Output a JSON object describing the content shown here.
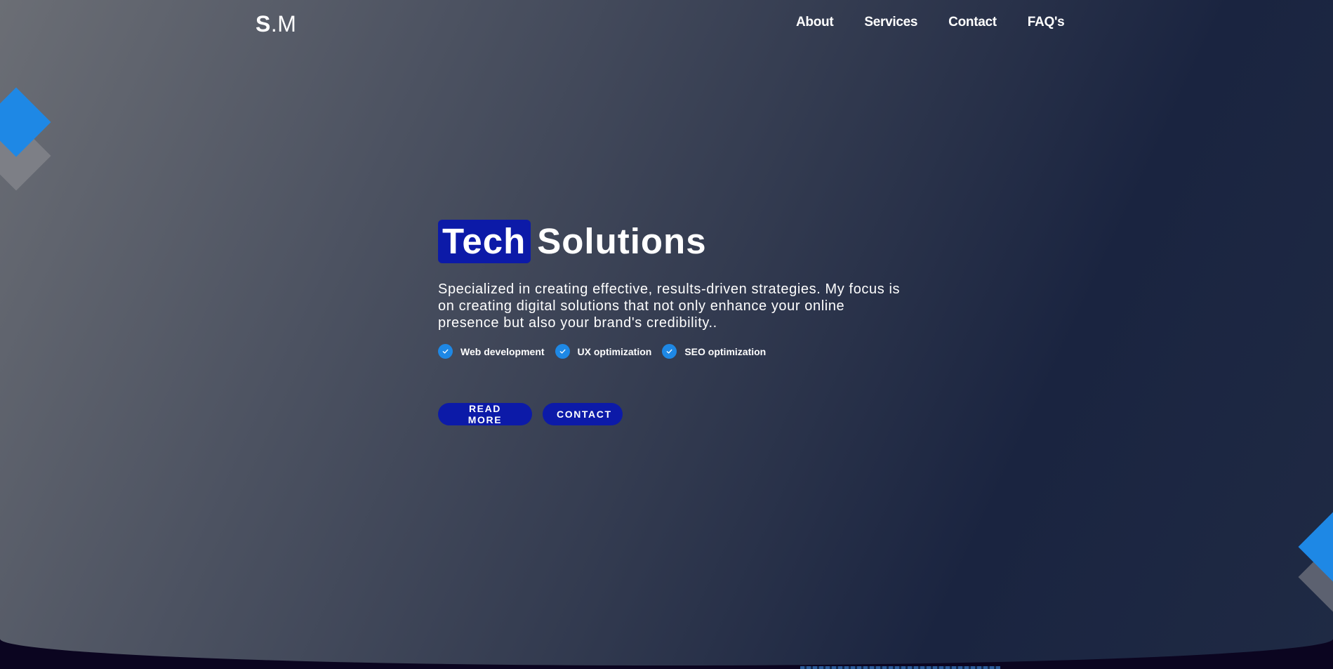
{
  "brand": {
    "logo_bold": "S",
    "logo_rest": ".M"
  },
  "nav": {
    "items": [
      {
        "label": "About"
      },
      {
        "label": "Services"
      },
      {
        "label": "Contact"
      },
      {
        "label": "FAQ's"
      }
    ]
  },
  "hero": {
    "title_highlight": "Tech",
    "title_rest": "Solutions",
    "description": "Specialized in creating effective, results-driven strategies. My focus is on creating digital solutions that not only enhance your online presence but also your brand's credibility..",
    "features": [
      {
        "label": "Web development",
        "icon": "check-icon"
      },
      {
        "label": "UX optimization",
        "icon": "check-icon"
      },
      {
        "label": "SEO optimization",
        "icon": "check-icon"
      }
    ],
    "buttons": {
      "read_more": "READ MORE",
      "contact": "CONTACT"
    }
  },
  "colors": {
    "accent_blue": "#1e88e5",
    "button_blue": "#0c1aa8",
    "highlight_blue": "#0c1aa8",
    "footer_dark": "#0b0520"
  }
}
